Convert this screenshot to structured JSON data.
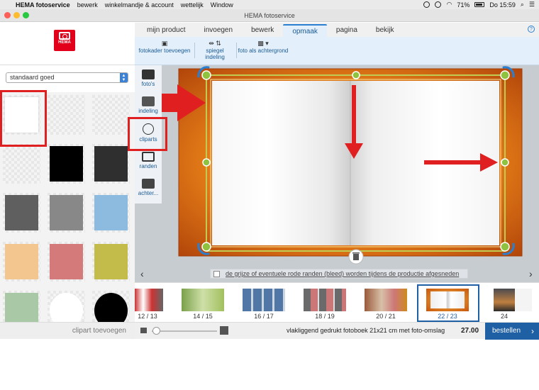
{
  "menubar": {
    "items": [
      "HEMA fotoservice",
      "bewerk",
      "winkelmandje & account",
      "wettelijk",
      "Window"
    ],
    "battery": "71%",
    "clock": "Do 15:59"
  },
  "window": {
    "title": "HEMA fotoservice"
  },
  "brand": {
    "logo_text": "HEMA",
    "accent": "#e3001b"
  },
  "tabs": [
    {
      "label": "mijn product"
    },
    {
      "label": "invoegen"
    },
    {
      "label": "bewerk"
    },
    {
      "label": "opmaak",
      "active": true
    },
    {
      "label": "pagina"
    },
    {
      "label": "bekijk"
    }
  ],
  "help_label": "?",
  "toolbar": {
    "photo_frame_add": "fotokader toevoegen",
    "mirror_layout": "spiegel indeling",
    "photo_as_background": "foto als achtergrond"
  },
  "left_panel": {
    "dropdown_value": "standaard goed",
    "add_clipart": "clipart toevoegen"
  },
  "side_tools": [
    {
      "label": "foto's",
      "icon": "camera-icon"
    },
    {
      "label": "indeling",
      "icon": "layout-icon"
    },
    {
      "label": "cliparts",
      "icon": "smiley-icon"
    },
    {
      "label": "randen",
      "icon": "border-icon"
    },
    {
      "label": "achter...",
      "icon": "background-icon"
    }
  ],
  "canvas": {
    "bleed_notice": "de grijze of eventuele rode randen (bleed) worden tijdens de productie afgesneden"
  },
  "filmstrip": {
    "pages": [
      {
        "label": "12 / 13"
      },
      {
        "label": "14 / 15"
      },
      {
        "label": "16 / 17"
      },
      {
        "label": "18 / 19"
      },
      {
        "label": "20 / 21"
      },
      {
        "label": "22 / 23",
        "selected": true
      },
      {
        "label": "24"
      }
    ]
  },
  "bottombar": {
    "product_description": "vlakliggend gedrukt fotoboek 21x21 cm met foto-omslag",
    "price": "27.00",
    "order_button": "bestellen"
  },
  "colors": {
    "highlight_red": "#e02020",
    "selected_blue": "#1f5fa3",
    "frame_green": "#8fc23f"
  }
}
